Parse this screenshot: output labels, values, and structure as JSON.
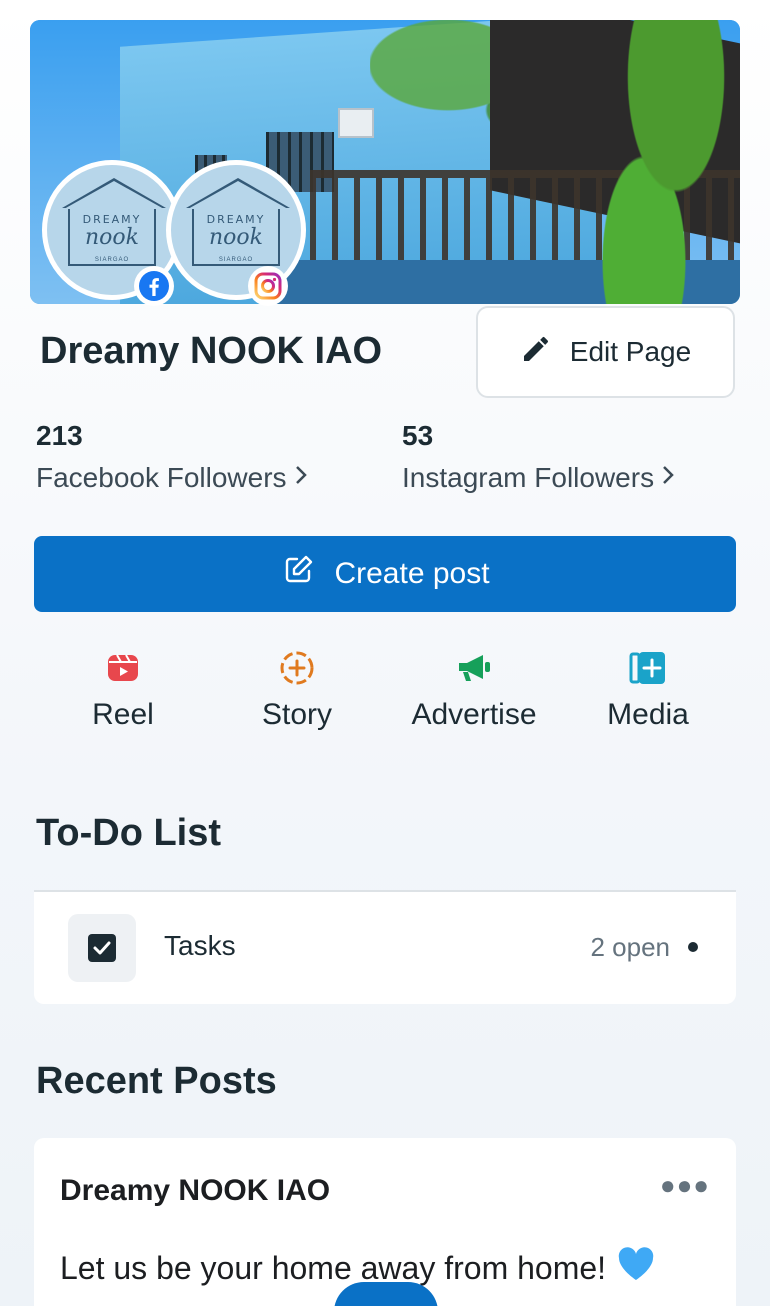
{
  "page": {
    "title": "Dreamy NOOK IAO",
    "edit_button": "Edit Page"
  },
  "avatar": {
    "logo_top": "DREAMY",
    "logo_main": "nook",
    "logo_sub": "SIARGAO"
  },
  "followers": {
    "facebook": {
      "count": "213",
      "label": "Facebook Followers"
    },
    "instagram": {
      "count": "53",
      "label": "Instagram Followers"
    }
  },
  "create_post": {
    "label": "Create post"
  },
  "actions": [
    {
      "label": "Reel",
      "icon": "reel-icon",
      "color": "#e8474d"
    },
    {
      "label": "Story",
      "icon": "story-plus-icon",
      "color": "#e07a1f"
    },
    {
      "label": "Advertise",
      "icon": "megaphone-icon",
      "color": "#16a05a"
    },
    {
      "label": "Media",
      "icon": "media-plus-icon",
      "color": "#1aa3c9"
    }
  ],
  "todo": {
    "heading": "To-Do List",
    "tasks_label": "Tasks",
    "tasks_status": "2 open"
  },
  "recent_posts": {
    "heading": "Recent Posts",
    "post": {
      "author": "Dreamy NOOK IAO",
      "text": "Let us be your home away from home!",
      "emoji": "💙"
    }
  },
  "colors": {
    "primary": "#0a71c6",
    "text": "#1c2b33",
    "facebook": "#1877f2"
  }
}
